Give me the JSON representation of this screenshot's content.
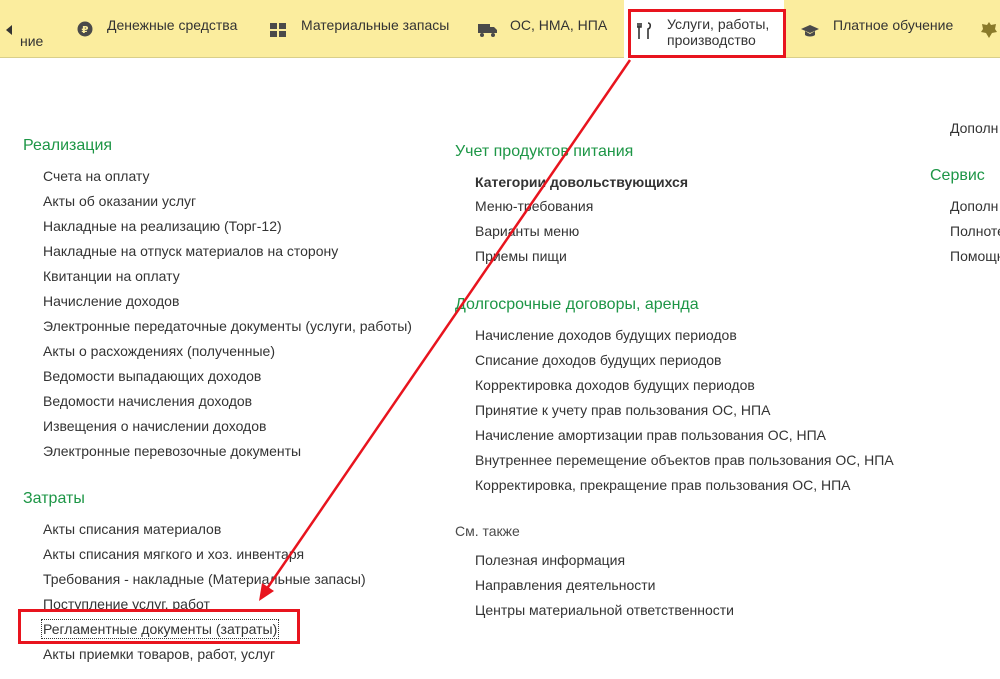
{
  "topbar": {
    "partial_label": "ние",
    "items": [
      {
        "label": "Денежные средства",
        "icon": "ruble-coin-icon"
      },
      {
        "label": "Материальные запасы",
        "icon": "grid-blocks-icon"
      },
      {
        "label": "ОС, НМА, НПА",
        "icon": "truck-icon"
      },
      {
        "label_line1": "Услуги, работы,",
        "label_line2": "производство",
        "icon": "tools-icon",
        "active": true
      },
      {
        "label": "Платное обучение",
        "icon": "graduation-cap-icon"
      },
      {
        "icon": "emblem-icon"
      }
    ]
  },
  "col1": {
    "realization": {
      "title": "Реализация",
      "items": [
        "Счета на оплату",
        "Акты об оказании услуг",
        "Накладные на реализацию (Торг-12)",
        "Накладные на отпуск материалов на сторону",
        "Квитанции на оплату",
        "Начисление доходов",
        "Электронные передаточные документы (услуги, работы)",
        "Акты о расхождениях (полученные)",
        "Ведомости выпадающих доходов",
        "Ведомости начисления доходов",
        "Извещения о начислении доходов",
        "Электронные перевозочные документы"
      ]
    },
    "costs": {
      "title": "Затраты",
      "items": [
        "Акты списания материалов",
        "Акты списания мягкого и хоз. инвентаря",
        "Требования - накладные (Материальные запасы)",
        "Поступление услуг, работ",
        "Регламентные документы (затраты)",
        "Акты приемки товаров, работ, услуг"
      ]
    }
  },
  "col2": {
    "food": {
      "title": "Учет продуктов питания",
      "items": [
        "Категории довольствующихся",
        "Меню-требования",
        "Варианты меню",
        "Приемы пищи"
      ]
    },
    "longterm": {
      "title": "Долгосрочные договоры, аренда",
      "items": [
        "Начисление доходов будущих периодов",
        "Списание доходов будущих периодов",
        "Корректировка доходов будущих периодов",
        "Принятие к учету прав пользования ОС, НПА",
        "Начисление амортизации прав пользования ОС, НПА",
        "Внутреннее перемещение объектов прав пользования ОС, НПА",
        "Корректировка, прекращение прав пользования ОС, НПА"
      ]
    },
    "see_also": {
      "title": "См. также",
      "items": [
        "Полезная информация",
        "Направления деятельности",
        "Центры материальной ответственности"
      ]
    }
  },
  "col3": {
    "top_item": "Дополн",
    "service": {
      "title": "Сервис",
      "items": [
        "Дополн",
        "Полноте",
        "Помощн"
      ]
    }
  },
  "colors": {
    "topbar_bg": "#fbed9e",
    "section_title": "#1d9646",
    "highlight": "#e8141e"
  }
}
